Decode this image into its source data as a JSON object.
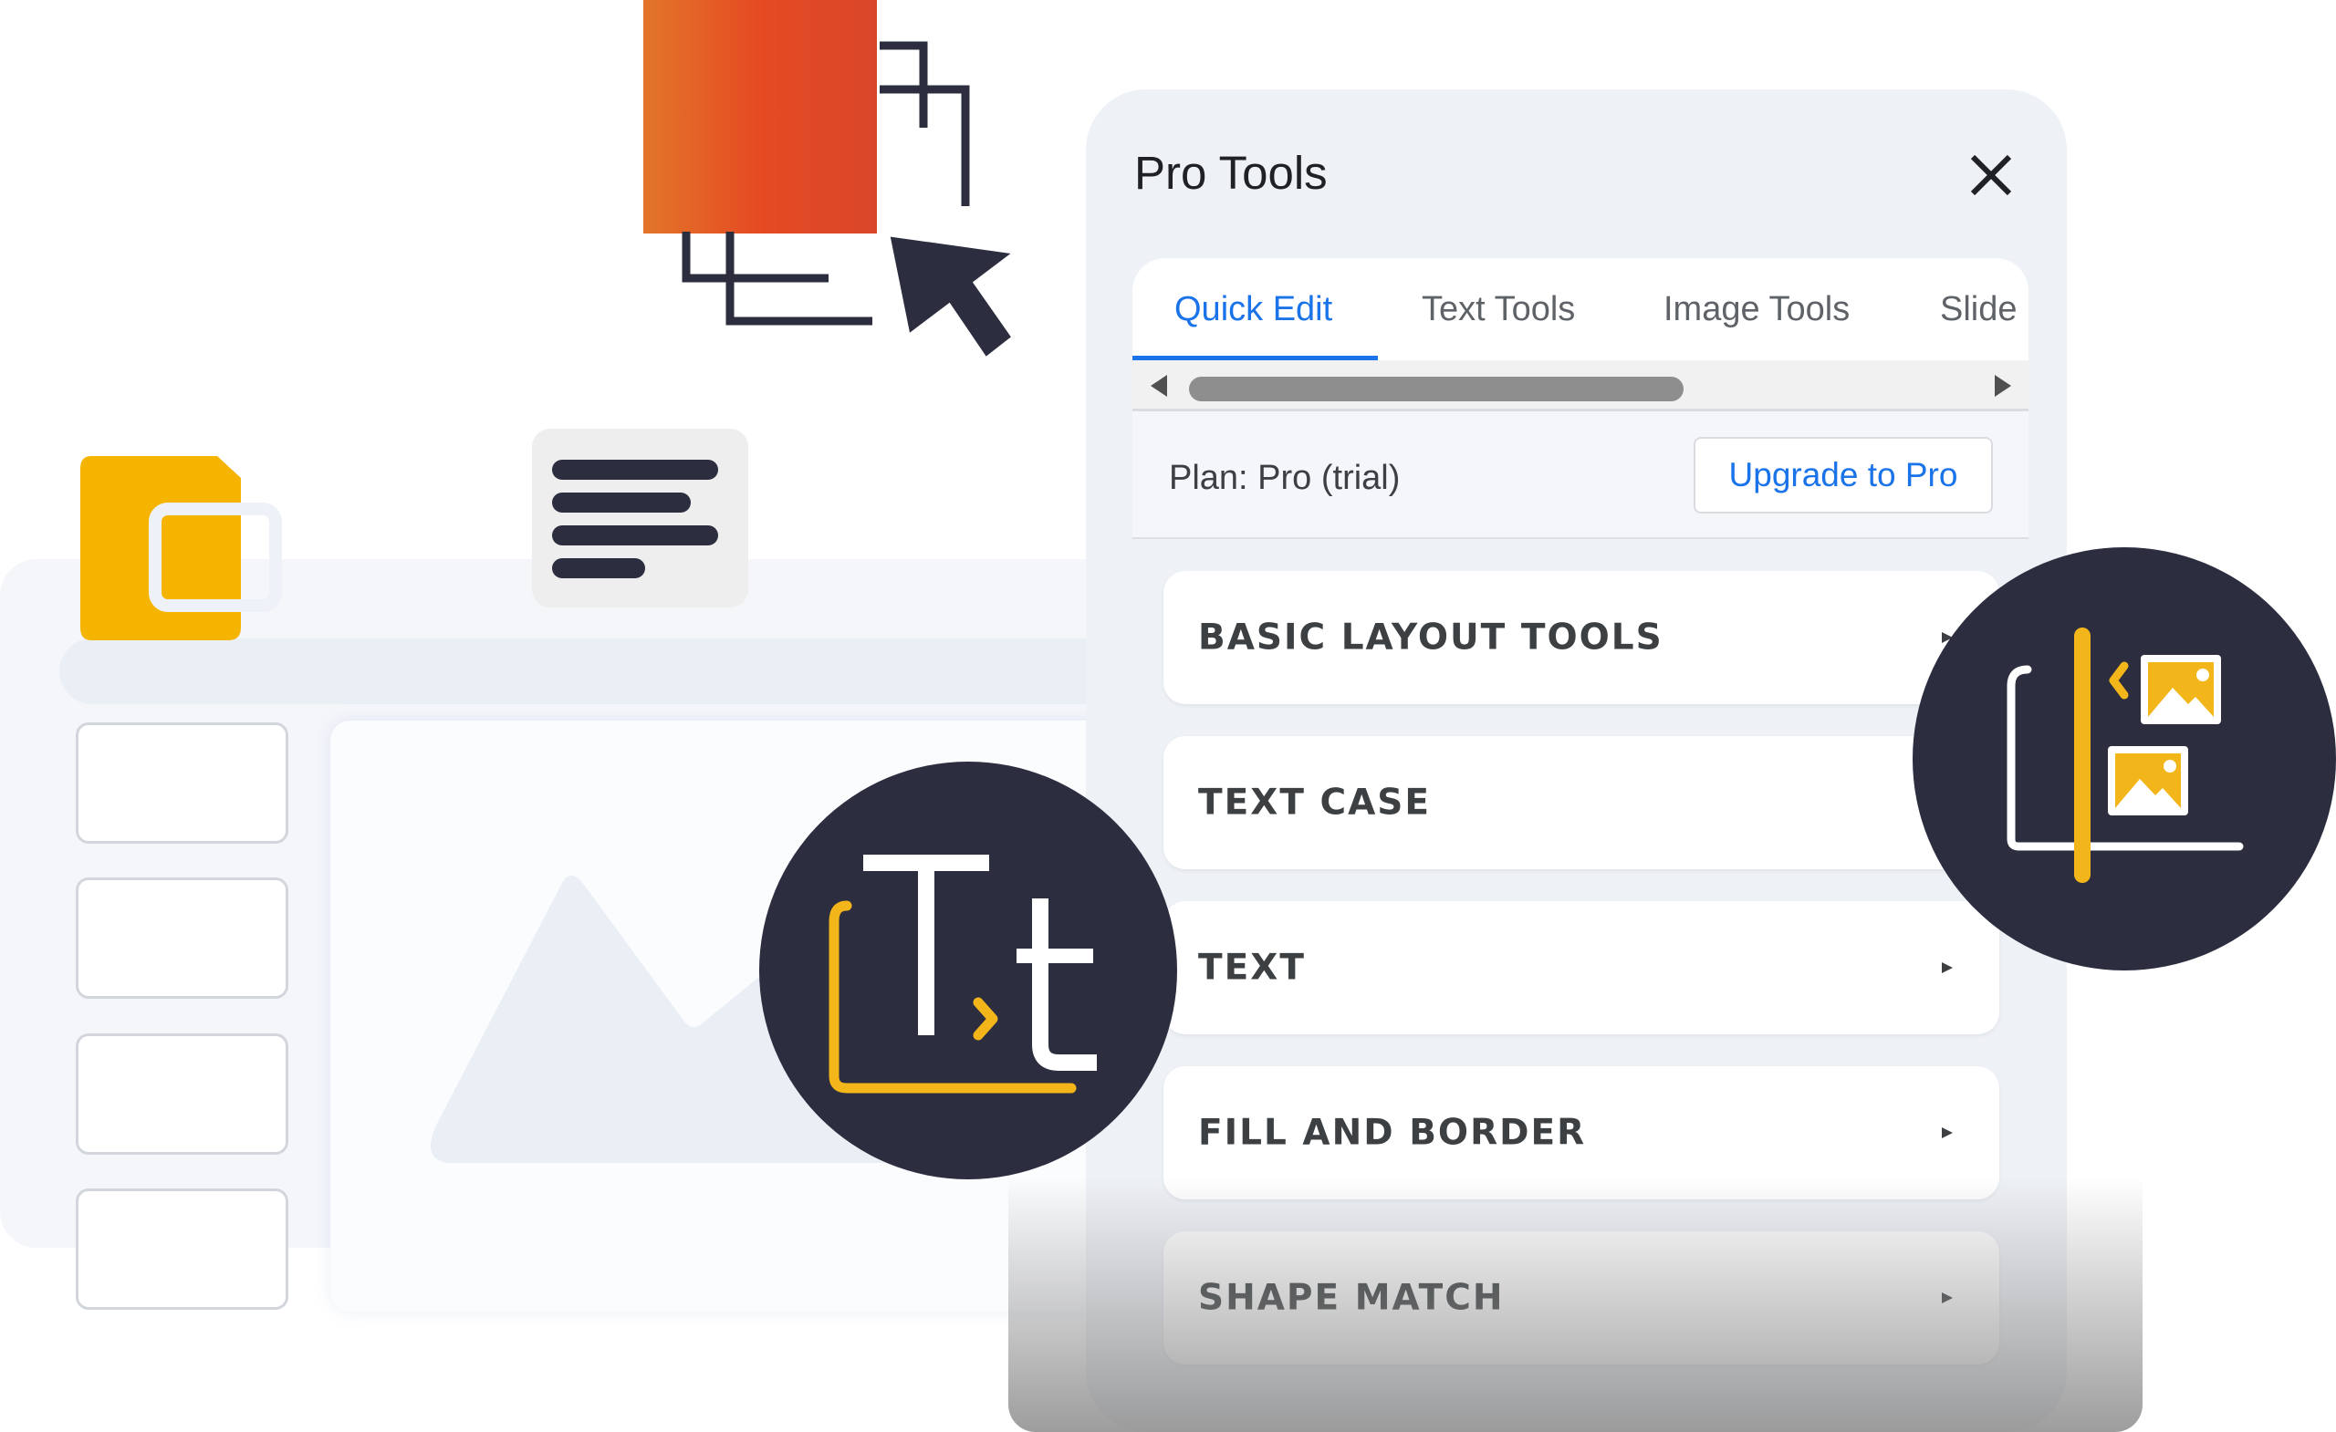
{
  "panel": {
    "title": "Pro Tools",
    "tabs": [
      {
        "label": "Quick Edit",
        "active": true
      },
      {
        "label": "Text Tools",
        "active": false
      },
      {
        "label": "Image Tools",
        "active": false
      },
      {
        "label": "Slide",
        "active": false
      }
    ],
    "plan_label": "Plan: Pro (trial)",
    "upgrade_label": "Upgrade to Pro",
    "sections": [
      {
        "label": "BASIC LAYOUT TOOLS"
      },
      {
        "label": "TEXT CASE"
      },
      {
        "label": "TEXT"
      },
      {
        "label": "FILL AND BORDER"
      },
      {
        "label": "SHAPE MATCH"
      }
    ]
  },
  "icons": {
    "close": "close-icon",
    "text_case_badge": "text-case-icon",
    "image_align_badge": "image-align-icon",
    "slides_logo": "slides-logo-icon",
    "align_left": "align-left-icon",
    "duplicate": "duplicate-icon",
    "cursor": "cursor-icon"
  },
  "colors": {
    "accent": "#1a73e8",
    "badge_bg": "#2c2d3e",
    "badge_yellow": "#f3b61a",
    "slides_yellow": "#f4b400",
    "orange_start": "#e2762a",
    "orange_end": "#d9472a"
  }
}
